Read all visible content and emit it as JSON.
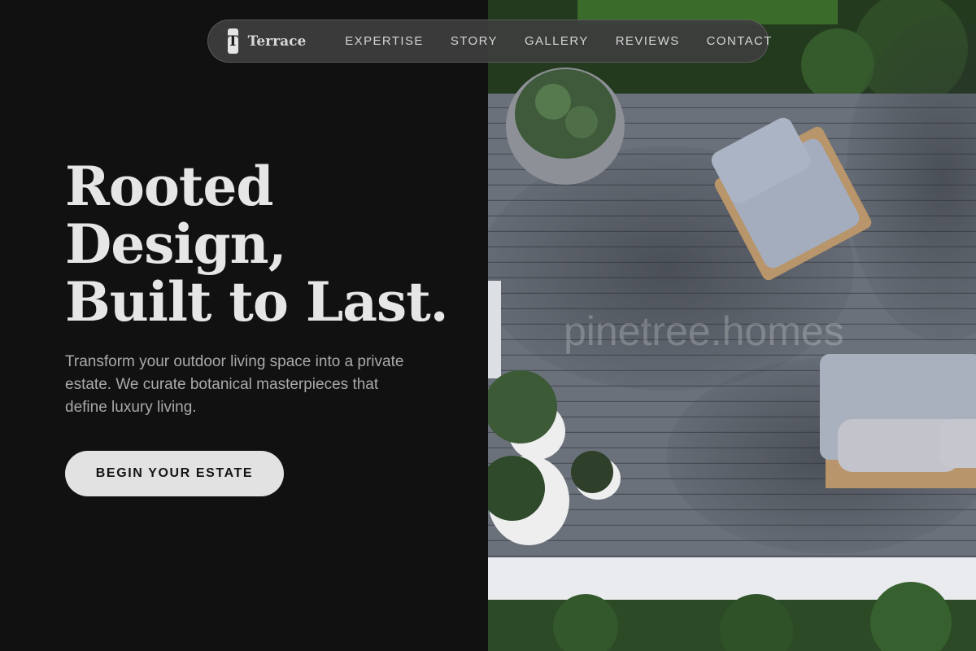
{
  "nav": {
    "logo_letter": "T",
    "brand": "Terrace",
    "links": [
      "EXPERTISE",
      "STORY",
      "GALLERY",
      "REVIEWS",
      "CONTACT"
    ]
  },
  "hero": {
    "title_lines": [
      "Rooted",
      "Design,",
      "Built to Last."
    ],
    "subtitle": "Transform your outdoor living space into a private estate. We curate botanical masterpieces that define luxury living.",
    "cta_label": "BEGIN YOUR ESTATE"
  },
  "image": {
    "watermark": "pinetree.homes"
  },
  "colors": {
    "background": "#111111",
    "title": "#e6e6e6",
    "subtitle": "#a9a9a9",
    "cta_bg": "#e2e2e2",
    "nav_bg": "#3e3e3e"
  }
}
